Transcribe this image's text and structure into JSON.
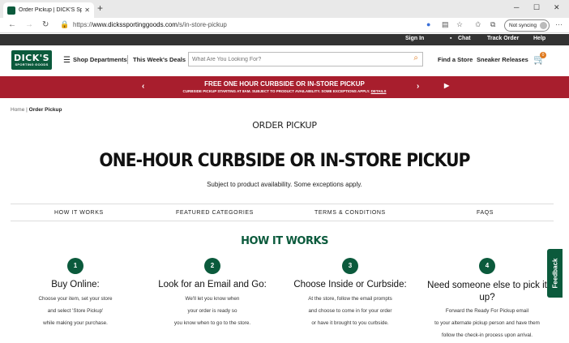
{
  "browser": {
    "tab_title": "Order Pickup | DICK'S Sporting Goods",
    "url_scheme": "https://",
    "url_host": "www.dickssportinggoods.com",
    "url_path": "/s/in-store-pickup",
    "sync_label": "Not syncing"
  },
  "utility_nav": {
    "sign_in": "Sign In",
    "chat": "Chat",
    "track_order": "Track Order",
    "help": "Help"
  },
  "header": {
    "logo_line1": "DICK'S",
    "logo_line2": "SPORTING GOODS",
    "shop_departments": "Shop Departments",
    "weekly_deals": "This Week's Deals",
    "search_placeholder": "What Are You Looking For?",
    "find_store": "Find a Store",
    "sneaker_releases": "Sneaker Releases",
    "cart_count": "0"
  },
  "promo": {
    "title": "FREE ONE HOUR CURBSIDE OR IN-STORE PICKUP",
    "subtitle": "CURBSIDE PICKUP STARTING AT 8AM. SUBJECT TO PRODUCT AVAILABILITY. SOME EXCEPTIONS APPLY.",
    "details_link": "DETAILS"
  },
  "breadcrumb": {
    "home": "Home",
    "separator": "|",
    "current": "Order Pickup"
  },
  "page": {
    "title": "ORDER PICKUP",
    "hero": "ONE-HOUR CURBSIDE OR IN-STORE PICKUP",
    "subject": "Subject to product availability. Some exceptions apply."
  },
  "subnav": {
    "how_it_works": "HOW IT WORKS",
    "featured_categories": "FEATURED CATEGORIES",
    "terms": "TERMS & CONDITIONS",
    "faqs": "FAQS"
  },
  "how_it_works": {
    "heading": "HOW IT WORKS",
    "steps": [
      {
        "num": "1",
        "title": "Buy Online:",
        "lines": [
          "Choose your item, set your store",
          "and select 'Store Pickup'",
          "while making your purchase."
        ]
      },
      {
        "num": "2",
        "title": "Look for an Email and Go:",
        "lines": [
          "We'll let you know when",
          "your order is ready so",
          "you know when to go to the store."
        ]
      },
      {
        "num": "3",
        "title": "Choose Inside or Curbside:",
        "lines": [
          "At the store, follow the email prompts",
          "and choose to come in for your order",
          "or have it brought to you curbside."
        ]
      },
      {
        "num": "4",
        "title": "Need someone else to pick it up?",
        "lines": [
          "Forward the Ready For Pickup email",
          "to your alternate pickup person and have them",
          "follow the check-in process upon arrival."
        ]
      }
    ]
  },
  "feedback_label": "Feedback",
  "colors": {
    "brand_green": "#0b5a3c",
    "promo_red": "#a81e2d",
    "accent_orange": "#e07a1f"
  }
}
